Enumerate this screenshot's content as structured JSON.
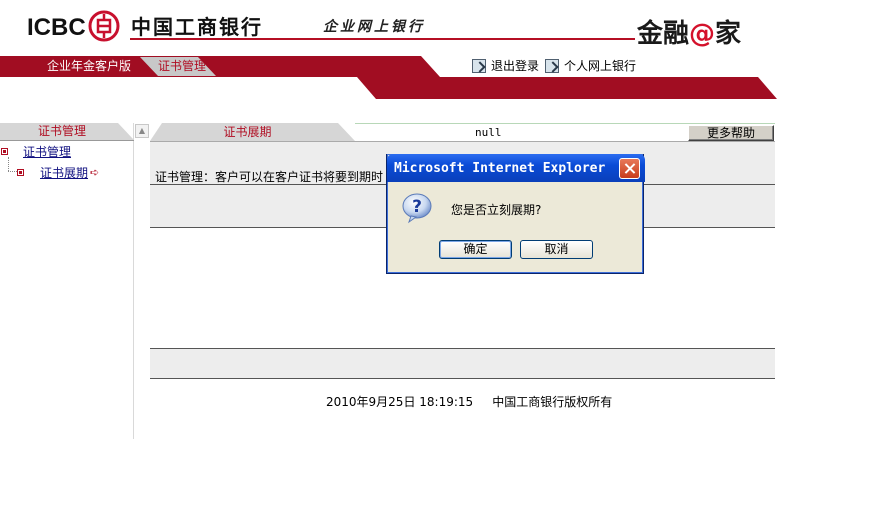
{
  "header": {
    "logo_text": "ICBC",
    "logo_icon": "icbc-seal-icon",
    "bank_name": "中国工商银行",
    "slogan": "企业网上银行",
    "brand_prefix": "金融",
    "brand_at": "@",
    "brand_suffix": "家",
    "accent_color": "#b50f24"
  },
  "nav": {
    "tabs": [
      {
        "label": "企业年金客户版",
        "active": false
      },
      {
        "label": "证书管理",
        "active": true
      }
    ],
    "links": [
      {
        "label": "退出登录",
        "icon": "logout-icon"
      },
      {
        "label": "个人网上银行",
        "icon": "personal-banking-icon"
      }
    ]
  },
  "sidebar": {
    "header": "证书管理",
    "tree": {
      "root": "证书管理",
      "child": "证书展期",
      "child_icon": "arrow-right-icon"
    }
  },
  "main": {
    "tab_label": "证书展期",
    "null_text": "null",
    "help_button": "更多帮助",
    "description": "证书管理：客户可以在客户证书将要到期时",
    "footer_date": "2010年9月25日 18:19:15",
    "footer_copyright": "中国工商银行版权所有"
  },
  "dialog": {
    "title": "Microsoft Internet Explorer",
    "icon": "question-icon",
    "message": "您是否立刻展期?",
    "ok_label": "确定",
    "cancel_label": "取消"
  }
}
